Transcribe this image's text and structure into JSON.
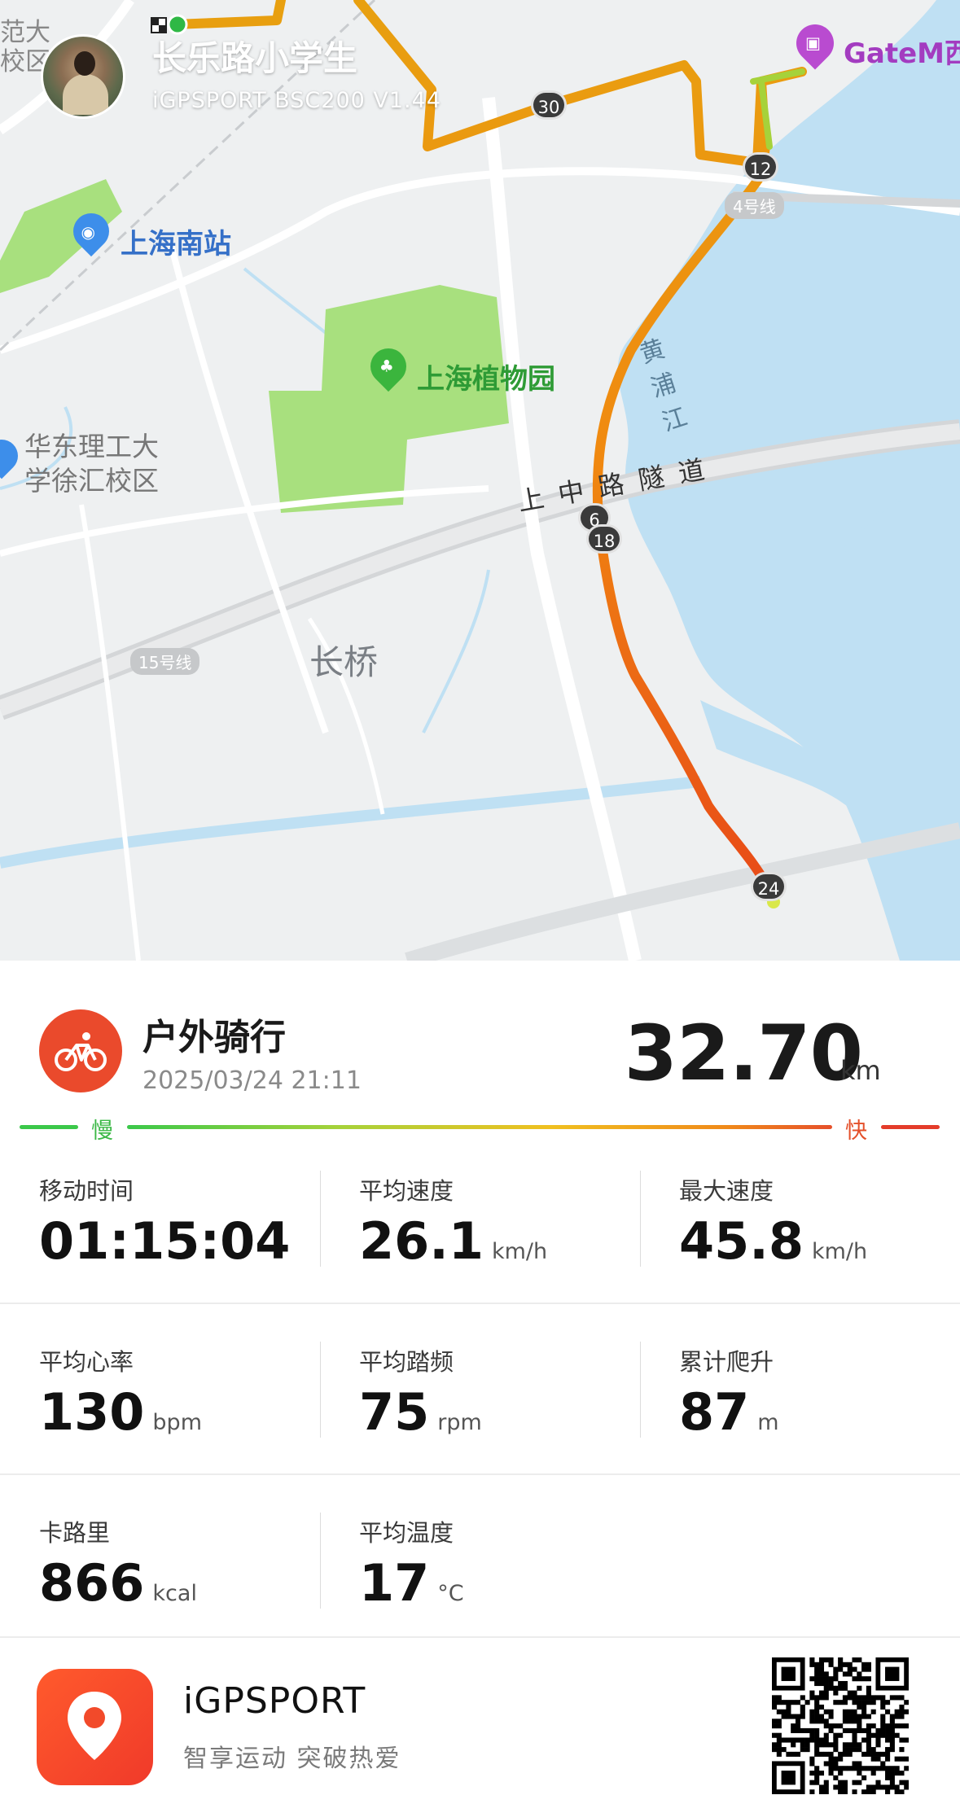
{
  "header": {
    "user_name": "长乐路小学生",
    "device_name": "iGPSPORT BSC200 V1.44"
  },
  "map": {
    "labels": {
      "south_station": "上海南站",
      "botanical_garden": "上海植物园",
      "ecust": "华东理工大学徐汇校区",
      "ecust_line1": "华东理工大",
      "ecust_line2": "学徐汇校区",
      "tunnel": "上中路隧道",
      "changqiao": "长桥",
      "river": "黄浦江",
      "line15": "15号线",
      "gatem": "GateM西",
      "fragment_top_left_1": "范大",
      "fragment_top_left_2": "校区",
      "line_label_right": "4号线"
    },
    "km_markers": [
      "30",
      "12",
      "6",
      "18",
      "24"
    ]
  },
  "summary": {
    "sport_type": "户外骑行",
    "datetime": "2025/03/24 21:11",
    "distance": "32.70",
    "distance_unit": "km",
    "slow_label": "慢",
    "fast_label": "快"
  },
  "stats": [
    {
      "label": "移动时间",
      "value": "01:15:04",
      "unit": ""
    },
    {
      "label": "平均速度",
      "value": "26.1",
      "unit": "km/h"
    },
    {
      "label": "最大速度",
      "value": "45.8",
      "unit": "km/h"
    },
    {
      "label": "平均心率",
      "value": "130",
      "unit": "bpm"
    },
    {
      "label": "平均踏频",
      "value": "75",
      "unit": "rpm"
    },
    {
      "label": "累计爬升",
      "value": "87",
      "unit": "m"
    },
    {
      "label": "卡路里",
      "value": "866",
      "unit": "kcal"
    },
    {
      "label": "平均温度",
      "value": "17",
      "unit": "°C"
    }
  ],
  "footer": {
    "app_name": "iGPSPORT",
    "slogan": "智享运动 突破热爱"
  },
  "colors": {
    "accent_red": "#ea4a2c",
    "route_orange": "#f08a1a",
    "green": "#3bc84a",
    "water": "#bfe0f3",
    "park": "#9ee07a"
  }
}
